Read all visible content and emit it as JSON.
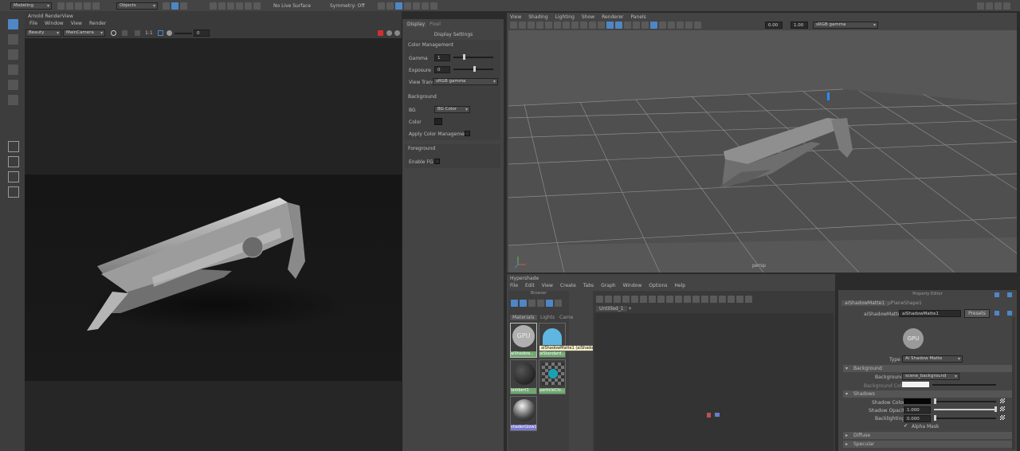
{
  "top_shelf": {
    "menu_set": "Modeling",
    "select_mode": "Objects",
    "live_surface": "No Live Surface",
    "symmetry": "Symmetry: Off"
  },
  "render_view": {
    "title": "Arnold RenderView",
    "menu": [
      "File",
      "Window",
      "View",
      "Render"
    ],
    "aov": "Beauty",
    "camera": "MainCamera",
    "ratio": "1:1",
    "exposure_value": "0",
    "tabs": [
      "Display",
      "Pixel"
    ],
    "display_settings": {
      "title": "Display Settings",
      "color_management": {
        "heading": "Color Management",
        "gamma_label": "Gamma",
        "gamma_value": "1",
        "exposure_label": "Exposure",
        "exposure_value": "0",
        "view_transform_label": "View Transform",
        "view_transform_value": "sRGB gamma"
      },
      "background": {
        "heading": "Background",
        "bg_label": "BG",
        "bg_value": "BG Color",
        "color_label": "Color",
        "apply_cm_label": "Apply Color Management"
      },
      "foreground": {
        "heading": "Foreground",
        "enable_fg_label": "Enable FG"
      }
    }
  },
  "viewport": {
    "menu": [
      "View",
      "Shading",
      "Lighting",
      "Show",
      "Renderer",
      "Panels"
    ],
    "field_a": "0.00",
    "field_b": "1.00",
    "color_space": "sRGB gamma",
    "camera_label": "persp"
  },
  "hypershade": {
    "title": "Hypershade",
    "menu": [
      "File",
      "Edit",
      "View",
      "Create",
      "Tabs",
      "Graph",
      "Window",
      "Options",
      "Help"
    ],
    "browser_label": "Browser",
    "browser_tabs": [
      "Materials",
      "Lights",
      "Came"
    ],
    "materials": [
      {
        "name": "aiShadow...",
        "style": "gpu",
        "label_color": "#6fa86f"
      },
      {
        "name": "aiStandard...",
        "style": "standard",
        "label_color": "#6fa86f"
      },
      {
        "name": "lambert1",
        "style": "lambert",
        "label_color": "#6fa86f"
      },
      {
        "name": "particleClo...",
        "style": "checker",
        "label_color": "#6fa86f"
      },
      {
        "name": "shaderGlow1",
        "style": "glow",
        "label_color": "#7a7ad0"
      }
    ],
    "tooltip": "aiShadowMatte1 (aiShadowMatte)",
    "graph_tab": "Untitled_1",
    "graph_tab_add": "+"
  },
  "property_editor": {
    "title": "Property Editor",
    "tabs": [
      "aiShadowMatte1",
      "pPlaneShape1"
    ],
    "node_label": "aiShadowMatte:",
    "node_value": "aiShadowMatte1",
    "presets_label": "Presets",
    "gpu_label": "GPU",
    "type_label": "Type",
    "type_value": "Ai Shadow Matte",
    "sections": {
      "background": "Background",
      "shadows": "Shadows",
      "diffuse": "Diffuse",
      "specular": "Specular"
    },
    "background_label": "Background",
    "background_value": "scene_background",
    "background_color_label": "Background Color",
    "shadow_color_label": "Shadow Color",
    "shadow_opacity_label": "Shadow Opacity",
    "shadow_opacity_value": "1.000",
    "backlighting_label": "Backlighting",
    "backlighting_value": "0.000",
    "alpha_mask_label": "Alpha Mask"
  },
  "colors": {
    "accent": "#4f86c6",
    "panel": "#444444",
    "viewport_bg": "#575757",
    "render_bg": "#232323"
  }
}
